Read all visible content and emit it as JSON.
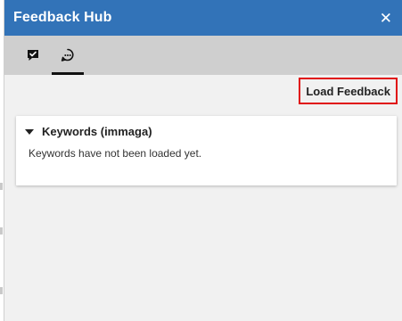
{
  "window": {
    "title": "Feedback Hub",
    "close_icon": "close-icon"
  },
  "tabs": [
    {
      "icon": "feedback-icon",
      "selected": false
    },
    {
      "icon": "keywords-icon",
      "selected": true
    }
  ],
  "actions": {
    "load_label": "Load Feedback"
  },
  "keywords_card": {
    "title": "Keywords (immaga)",
    "message": "Keywords have not been loaded yet.",
    "expanded": true
  },
  "colors": {
    "titlebar": "#3273b8",
    "tabbar": "#cfcfcf",
    "panel": "#f1f1f1",
    "highlight": "#e01010"
  }
}
